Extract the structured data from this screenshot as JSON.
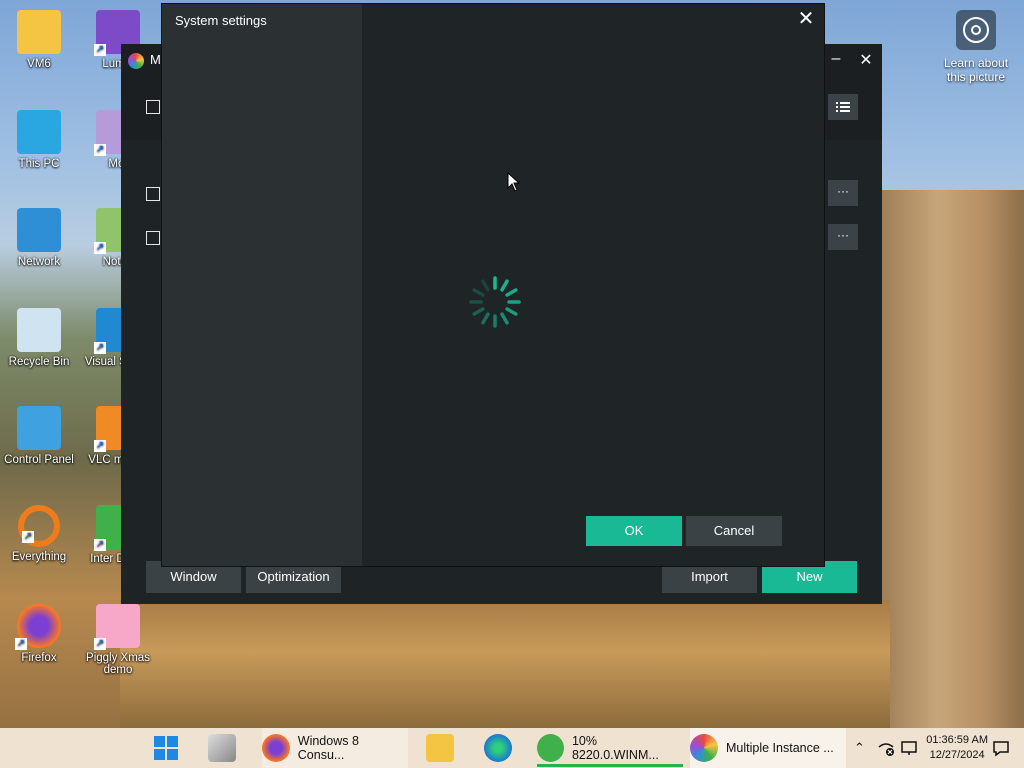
{
  "desktop": {
    "icons": [
      {
        "label": "VM6"
      },
      {
        "label": "Lumin"
      },
      {
        "label": "This PC"
      },
      {
        "label": "Mot"
      },
      {
        "label": "Network"
      },
      {
        "label": "Notep"
      },
      {
        "label": "Recycle Bin"
      },
      {
        "label": "Visual S Cod"
      },
      {
        "label": "Control Panel"
      },
      {
        "label": "VLC m play"
      },
      {
        "label": "Everything"
      },
      {
        "label": "Inter Down"
      },
      {
        "label": "Firefox"
      },
      {
        "label": "Piggly Xmas demo"
      }
    ],
    "learn_label": "Learn about this picture"
  },
  "app_window": {
    "title": "M",
    "bottom": {
      "window": "Window",
      "optimization": "Optimization",
      "import": "Import",
      "new": "New"
    },
    "more_label": "···"
  },
  "dialog": {
    "title": "System settings",
    "ok": "OK",
    "cancel": "Cancel",
    "close": "✕"
  },
  "taskbar": {
    "items": [
      {
        "label": "Windows 8 Consu..."
      },
      {
        "label": "10% 8220.0.WINM..."
      },
      {
        "label": "Multiple Instance ..."
      }
    ],
    "time": "01:36:59 AM",
    "date": "12/27/2024"
  },
  "colors": {
    "accent": "#19b996",
    "dialog_bg": "#1f2427",
    "dialog_sidebar": "#2b3033"
  }
}
